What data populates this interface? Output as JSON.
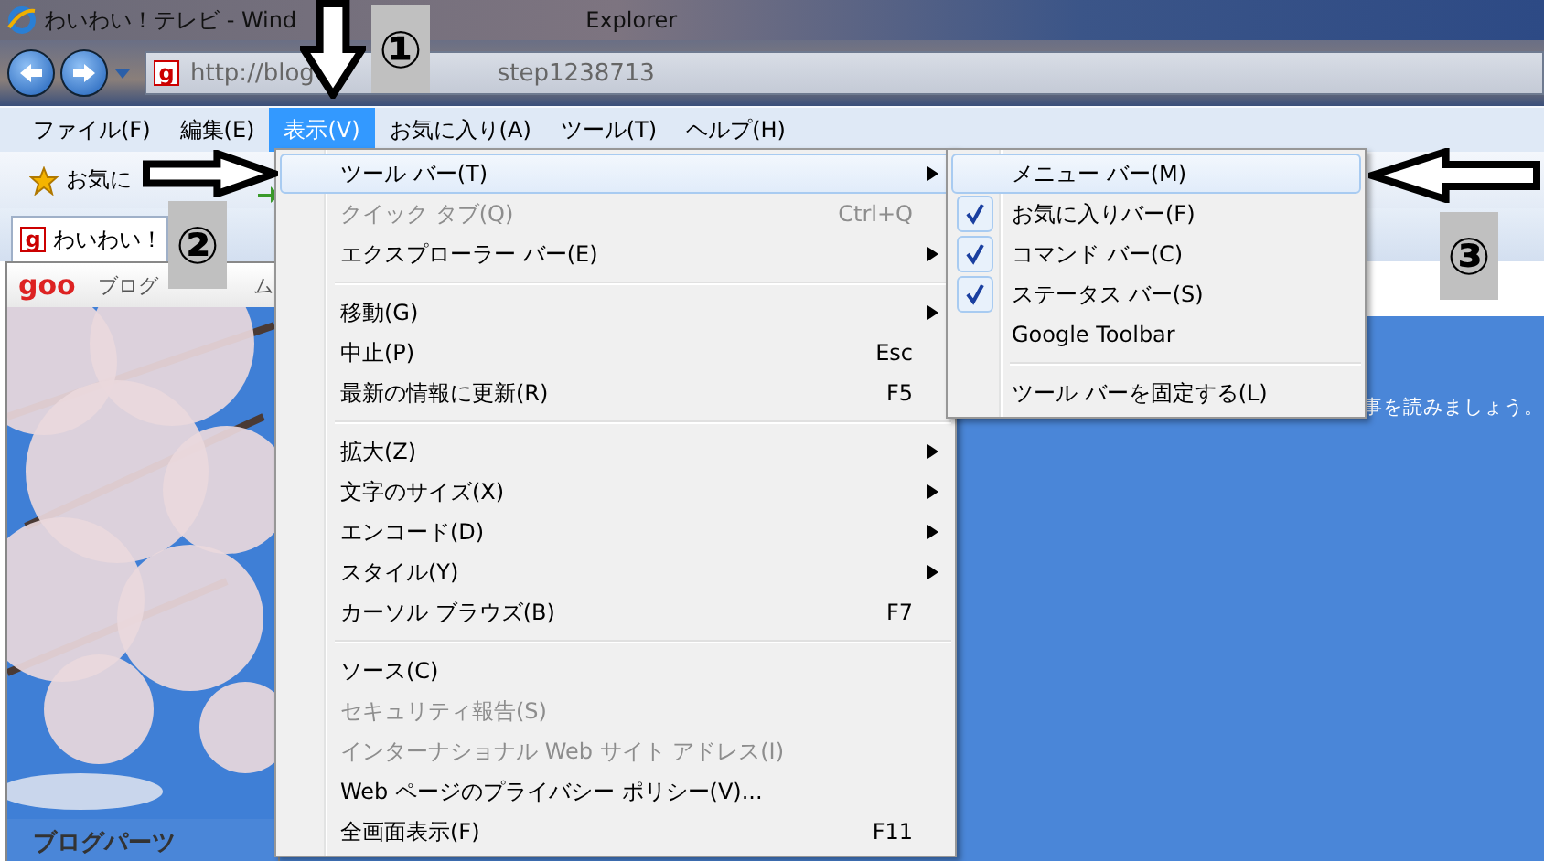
{
  "window": {
    "title_parts": [
      "わいわい！テレビ - Wind",
      "Explorer"
    ]
  },
  "address_bar": {
    "favicon": "g",
    "url_parts": [
      "http://blog",
      "step1238713"
    ]
  },
  "menu_bar": [
    {
      "label": "ファイル(F)",
      "selected": false
    },
    {
      "label": "編集(E)",
      "selected": false
    },
    {
      "label": "表示(V)",
      "selected": true
    },
    {
      "label": "お気に入り(A)",
      "selected": false
    },
    {
      "label": "ツール(T)",
      "selected": false
    },
    {
      "label": "ヘルプ(H)",
      "selected": false
    }
  ],
  "favorites_bar": {
    "label": "お気に"
  },
  "tab": {
    "favicon": "g",
    "title": "わいわい！"
  },
  "page": {
    "logo": "goo",
    "site_nav": [
      "ブログ",
      "ム"
    ],
    "sidebar_heading": "ブログパーツ",
    "content_text": "事を読みましょう。"
  },
  "view_menu": [
    {
      "kind": "item",
      "label": "ツール バー(T)",
      "submenu": true,
      "disabled": false,
      "selected": true
    },
    {
      "kind": "item",
      "label": "クイック タブ(Q)",
      "shortcut": "Ctrl+Q",
      "submenu": false,
      "disabled": true,
      "selected": false
    },
    {
      "kind": "item",
      "label": "エクスプローラー バー(E)",
      "submenu": true,
      "disabled": false,
      "selected": false
    },
    {
      "kind": "separator"
    },
    {
      "kind": "item",
      "label": "移動(G)",
      "submenu": true,
      "disabled": false,
      "selected": false
    },
    {
      "kind": "item",
      "label": "中止(P)",
      "shortcut": "Esc",
      "submenu": false,
      "disabled": false,
      "selected": false
    },
    {
      "kind": "item",
      "label": "最新の情報に更新(R)",
      "shortcut": "F5",
      "submenu": false,
      "disabled": false,
      "selected": false
    },
    {
      "kind": "separator"
    },
    {
      "kind": "item",
      "label": "拡大(Z)",
      "submenu": true,
      "disabled": false,
      "selected": false
    },
    {
      "kind": "item",
      "label": "文字のサイズ(X)",
      "submenu": true,
      "disabled": false,
      "selected": false
    },
    {
      "kind": "item",
      "label": "エンコード(D)",
      "submenu": true,
      "disabled": false,
      "selected": false
    },
    {
      "kind": "item",
      "label": "スタイル(Y)",
      "submenu": true,
      "disabled": false,
      "selected": false
    },
    {
      "kind": "item",
      "label": "カーソル ブラウズ(B)",
      "shortcut": "F7",
      "submenu": false,
      "disabled": false,
      "selected": false
    },
    {
      "kind": "separator"
    },
    {
      "kind": "item",
      "label": "ソース(C)",
      "submenu": false,
      "disabled": false,
      "selected": false
    },
    {
      "kind": "item",
      "label": "セキュリティ報告(S)",
      "submenu": false,
      "disabled": true,
      "selected": false
    },
    {
      "kind": "item",
      "label": "インターナショナル Web サイト アドレス(I)",
      "submenu": false,
      "disabled": true,
      "selected": false
    },
    {
      "kind": "item",
      "label": "Web ページのプライバシー ポリシー(V)...",
      "submenu": false,
      "disabled": false,
      "selected": false
    },
    {
      "kind": "item",
      "label": "全画面表示(F)",
      "shortcut": "F11",
      "submenu": false,
      "disabled": false,
      "selected": false
    }
  ],
  "toolbar_submenu": [
    {
      "kind": "item",
      "label": "メニュー バー(M)",
      "checked": false,
      "selected": true
    },
    {
      "kind": "item",
      "label": "お気に入りバー(F)",
      "checked": true,
      "selected": false
    },
    {
      "kind": "item",
      "label": "コマンド バー(C)",
      "checked": true,
      "selected": false
    },
    {
      "kind": "item",
      "label": "ステータス バー(S)",
      "checked": true,
      "selected": false
    },
    {
      "kind": "item",
      "label": "Google Toolbar",
      "checked": false,
      "selected": false
    },
    {
      "kind": "separator"
    },
    {
      "kind": "item",
      "label": "ツール バーを固定する(L)",
      "checked": false,
      "selected": false
    }
  ],
  "callouts": [
    {
      "number": "①"
    },
    {
      "number": "②"
    },
    {
      "number": "③"
    }
  ]
}
